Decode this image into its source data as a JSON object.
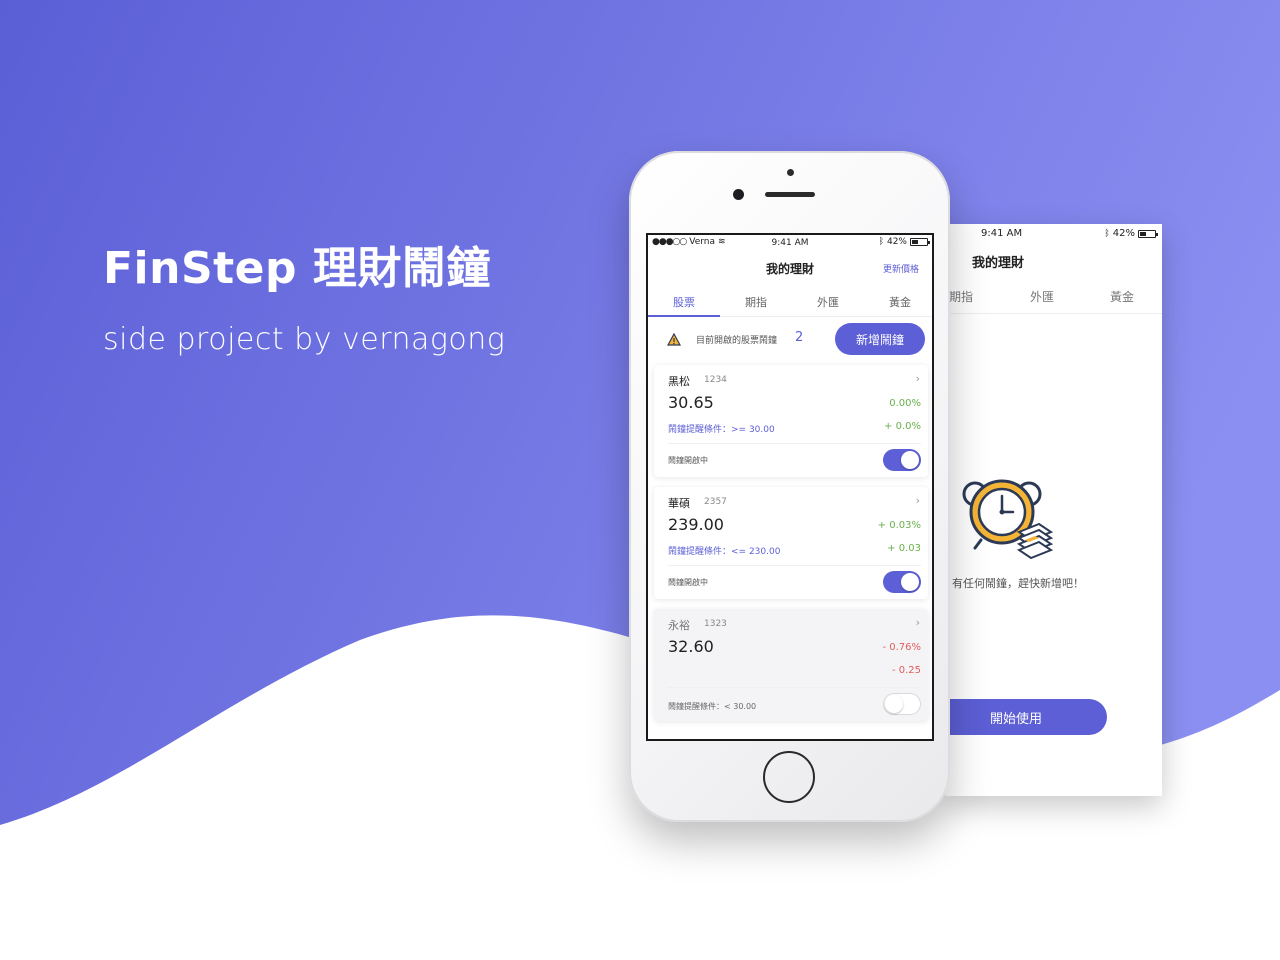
{
  "hero": {
    "title": "FinStep 理財鬧鐘",
    "subtitle": "side project by vernagong"
  },
  "colors": {
    "accent": "#5c5fd5",
    "gradient_start": "#5b5fd6",
    "gradient_end": "#8b8ff1",
    "up": "#6ab04c",
    "down": "#e05d5d"
  },
  "phone": {
    "status_bar": {
      "carrier": "Verna",
      "time": "9:41 AM",
      "battery": "42%",
      "battery_level": 0.42
    },
    "nav": {
      "title": "我的理財",
      "action": "更新價格"
    },
    "tabs": [
      {
        "label": "股票",
        "active": true
      },
      {
        "label": "期指",
        "active": false
      },
      {
        "label": "外匯",
        "active": false
      },
      {
        "label": "黃金",
        "active": false
      }
    ],
    "summary": {
      "label": "目前開啟的股票鬧鐘",
      "count": "2",
      "add_button": "新增鬧鐘"
    },
    "stocks": [
      {
        "name": "黑松",
        "code": "1234",
        "price": "30.65",
        "change_pct": "0.00%",
        "change": "+ 0.0%",
        "condition_label": "鬧鐘提醒條件：",
        "condition": ">= 30.00",
        "status": "鬧鐘開啟中",
        "enabled": true,
        "direction": "up"
      },
      {
        "name": "華碩",
        "code": "2357",
        "price": "239.00",
        "change_pct": "+ 0.03%",
        "change": "+ 0.03",
        "condition_label": "鬧鐘提醒條件：",
        "condition": "<= 230.00",
        "status": "鬧鐘開啟中",
        "enabled": true,
        "direction": "up"
      },
      {
        "name": "永裕",
        "code": "1323",
        "price": "32.60",
        "change_pct": "- 0.76%",
        "change": "- 0.25",
        "status": "鬧鐘提醒條件：< 30.00",
        "enabled": false,
        "direction": "down"
      }
    ]
  },
  "back_screen": {
    "status_bar": {
      "time": "9:41 AM",
      "battery": "42%",
      "battery_level": 0.42
    },
    "title": "我的理財",
    "tabs": [
      {
        "label": "期指"
      },
      {
        "label": "外匯"
      },
      {
        "label": "黃金"
      }
    ],
    "empty_message": "有任何鬧鐘，趕快新增吧！",
    "start_button": "開始使用"
  }
}
